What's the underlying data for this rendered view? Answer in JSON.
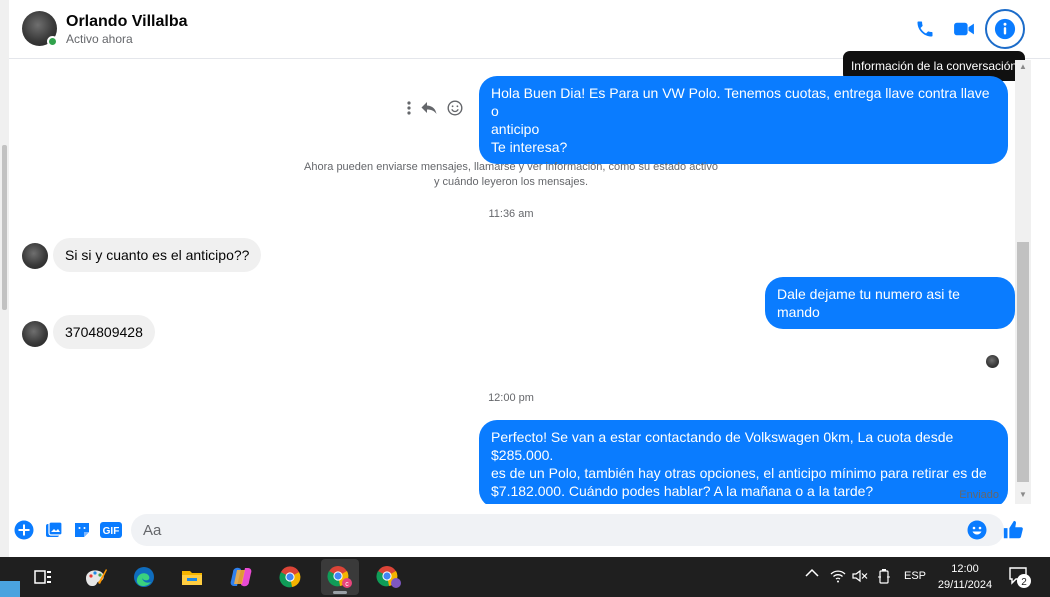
{
  "header": {
    "contact_name": "Orlando Villalba",
    "status": "Activo ahora",
    "icons": [
      "phone-icon",
      "video-icon",
      "info-icon"
    ],
    "tooltip": "Información de la conversación"
  },
  "messages": {
    "m1": {
      "line1": "Hola Buen Dia! Es Para un VW Polo. Tenemos cuotas, entrega llave contra llave o",
      "line2": "anticipo",
      "line3": "Te interesa?"
    },
    "system": {
      "line1": "Ahora pueden enviarse mensajes, llamarse y ver información, como su estado activo",
      "line2": "y cuándo leyeron los mensajes."
    },
    "time1": "11:36 am",
    "m2": "Si si y cuanto es el anticipo??",
    "m3": "Dale dejame tu numero asi te mando",
    "m4": "3704809428",
    "time2": "12:00 pm",
    "m5": {
      "line1": "Perfecto!  Se van a estar contactando de Volkswagen 0km, La cuota desde $285.000.",
      "line2": "es de un Polo, también hay otras opciones, el anticipo mínimo para retirar es de",
      "line3": "$7.182.000. Cuándo podes hablar? A la mañana o a la tarde?"
    },
    "delivery_status": "Enviado"
  },
  "composer": {
    "placeholder": "Aa",
    "value": "",
    "gif_label": "GIF"
  },
  "taskbar": {
    "apps": [
      "task-view",
      "paint",
      "edge",
      "file-explorer",
      "copilot",
      "chrome",
      "chrome-profile-c",
      "chrome-profile-2"
    ],
    "language": "ESP",
    "time": "12:00",
    "date": "29/11/2024",
    "notification_count": "2"
  },
  "colors": {
    "outgoing_bubble": "#0a7cff",
    "incoming_bubble": "#f0f0f0",
    "accent": "#0a7cff",
    "online": "#31a24c",
    "taskbar": "#1f1f1f"
  }
}
